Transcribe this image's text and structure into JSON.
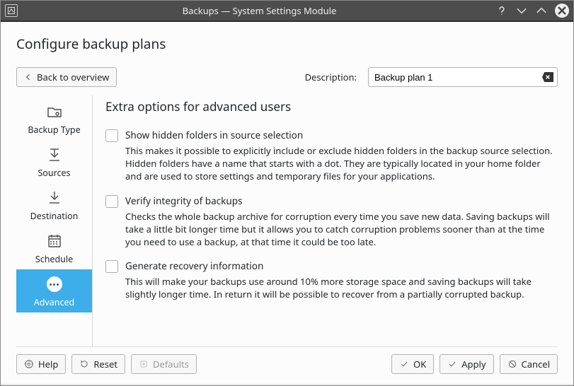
{
  "titlebar": {
    "title": "Backups — System Settings Module"
  },
  "page": {
    "heading": "Configure backup plans"
  },
  "back_button": "Back to overview",
  "description": {
    "label": "Description:",
    "value": "Backup plan 1"
  },
  "sidebar": {
    "items": [
      {
        "label": "Backup Type"
      },
      {
        "label": "Sources"
      },
      {
        "label": "Destination"
      },
      {
        "label": "Schedule"
      },
      {
        "label": "Advanced",
        "active": true
      }
    ]
  },
  "section": {
    "title": "Extra options for advanced users",
    "options": [
      {
        "title": "Show hidden folders in source selection",
        "desc": "This makes it possible to explicitly include or exclude hidden folders in the backup source selection. Hidden folders have a name that starts with a dot. They are typically located in your home folder and are used to store settings and temporary files for your applications."
      },
      {
        "title": "Verify integrity of backups",
        "desc": "Checks the whole backup archive for corruption every time you save new data. Saving backups will take a little bit longer time but it allows you to catch corruption problems sooner than at the time you need to use a backup, at that time it could be too late."
      },
      {
        "title": "Generate recovery information",
        "desc": "This will make your backups use around 10% more storage space and saving backups will take slightly longer time. In return it will be possible to recover from a partially corrupted backup."
      }
    ]
  },
  "footer": {
    "help": "Help",
    "reset": "Reset",
    "defaults": "Defaults",
    "ok": "OK",
    "apply": "Apply",
    "cancel": "Cancel"
  }
}
